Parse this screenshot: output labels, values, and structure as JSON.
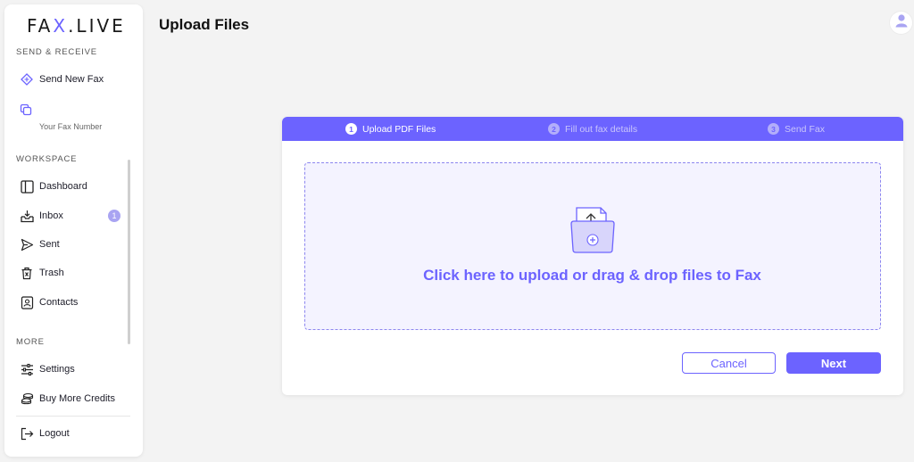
{
  "brand": {
    "logo_left": "FA",
    "logo_x": "X",
    "logo_right": ".LIVE",
    "accent": "#6c63ff"
  },
  "sidebar": {
    "send_section": "SEND & RECEIVE",
    "send_new_fax": {
      "label": "Send New Fax",
      "icon": "diamond-sign-icon"
    },
    "fax_number": {
      "label": "Your Fax Number",
      "icon": "copy-icon"
    },
    "workspace_section": "WORKSPACE",
    "workspace_items": [
      {
        "label": "Dashboard",
        "icon": "layout-panel-icon"
      },
      {
        "label": "Inbox",
        "icon": "inbox-tray-icon",
        "badge": "1"
      },
      {
        "label": "Sent",
        "icon": "send-arrow-icon"
      },
      {
        "label": "Trash",
        "icon": "trash-icon"
      },
      {
        "label": "Contacts",
        "icon": "contact-card-icon"
      }
    ],
    "more_section": "MORE",
    "more_items": [
      {
        "label": "Settings",
        "icon": "sliders-icon"
      },
      {
        "label": "Buy More Credits",
        "icon": "coins-icon"
      }
    ],
    "logout": {
      "label": "Logout",
      "icon": "logout-icon"
    }
  },
  "header": {
    "title": "Upload Files",
    "avatar_icon": "user-avatar-icon"
  },
  "wizard": {
    "steps": [
      {
        "number": "1",
        "label": "Upload PDF Files",
        "active": true
      },
      {
        "number": "2",
        "label": "Fill out fax details",
        "active": false
      },
      {
        "number": "3",
        "label": "Send Fax",
        "active": false
      }
    ],
    "dropzone_text": "Click here to upload or drag & drop files to Fax",
    "dropzone_icon": "folder-upload-icon",
    "cancel_label": "Cancel",
    "next_label": "Next"
  }
}
